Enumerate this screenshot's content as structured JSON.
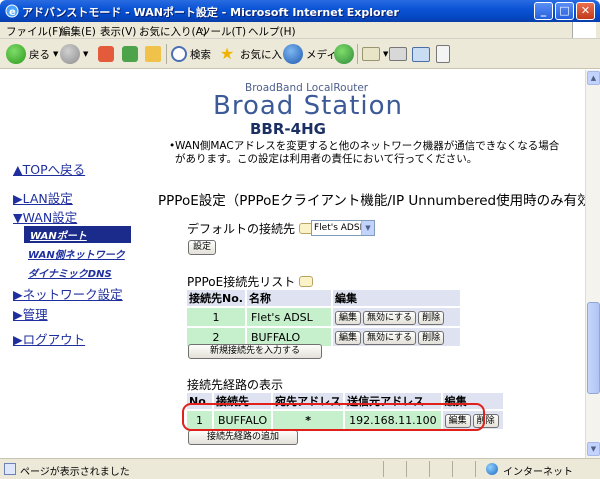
{
  "window": {
    "title": "アドバンストモード - WANポート設定 - Microsoft Internet Explorer"
  },
  "menu": [
    "ファイル(F)",
    "編集(E)",
    "表示(V)",
    "お気に入り(A)",
    "ツール(T)",
    "ヘルプ(H)"
  ],
  "toolbar": {
    "back": "戻る",
    "search": "検索",
    "favorites": "お気に入り",
    "media": "メディア"
  },
  "header": {
    "sub": "BroadBand LocalRouter",
    "main": "Broad Station",
    "model": "BBR-4HG"
  },
  "sidebar": {
    "top": "▲TOPへ戻る",
    "lan": "▶LAN設定",
    "wan": "▼WAN設定",
    "wan_port": "WANポート",
    "wan_network": "WAN側ネットワーク",
    "dynamic_dns": "ダイナミックDNS",
    "network": "▶ネットワーク設定",
    "admin": "▶管理",
    "logout": "▶ログアウト"
  },
  "notice": "WAN側MACアドレスを変更すると他のネットワーク機器が通信できなくなる場合があります。この設定は利用者の責任において行ってください。",
  "heading": "PPPoE設定（PPPoEクライアント機能/IP Unnumbered使用時のみ有効）",
  "default_conn": {
    "label": "デフォルトの接続先",
    "selected": "Flet's ADSL",
    "set_button": "設定"
  },
  "conn_list": {
    "title": "PPPoE接続先リスト",
    "headers": [
      "接続先No.",
      "名称",
      "編集"
    ],
    "rows": [
      {
        "no": "1",
        "name": "Flet's ADSL"
      },
      {
        "no": "2",
        "name": "BUFFALO"
      }
    ],
    "edit": "編集",
    "disable": "無効にする",
    "delete": "削除",
    "add_button": "新規接続先を入力する"
  },
  "route": {
    "title": "接続先経路の表示",
    "headers": [
      "No.",
      "接続先",
      "宛先アドレス",
      "送信元アドレス",
      "編集"
    ],
    "row": {
      "no": "1",
      "dest": "BUFFALO",
      "addr": "*",
      "src": "192.168.11.100"
    },
    "edit": "編集",
    "delete": "削除",
    "add_button": "接続先経路の追加"
  },
  "status": {
    "text": "ページが表示されました",
    "zone": "インターネット"
  },
  "colors": {
    "titlebar": "#0a54d6",
    "nav_link": "#1f2f9e",
    "active_nav": "#1b2b8c",
    "row_green": "#c6f0cc",
    "header_cell": "#dfe3f1",
    "highlight": "#e0201a"
  }
}
